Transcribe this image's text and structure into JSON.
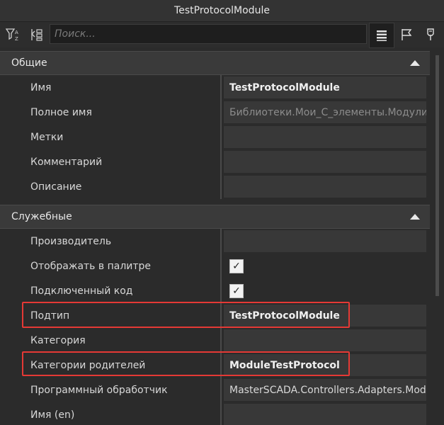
{
  "window": {
    "title": "TestProtocolModule"
  },
  "toolbar": {
    "search_placeholder": "Поиск...",
    "filter_icon": "filter-sort-icon",
    "categorize_icon": "categorize-icon",
    "list_icon": "list-icon",
    "flag_icon": "flag-icon",
    "pin_icon": "pin-icon"
  },
  "sections": [
    {
      "title": "Общие",
      "rows": [
        {
          "label": "Имя",
          "value": "TestProtocolModule"
        },
        {
          "label": "Полное имя",
          "value": "Библиотеки.Мои_С_элементы.Модули в"
        },
        {
          "label": "Метки",
          "value": ""
        },
        {
          "label": "Комментарий",
          "value": ""
        },
        {
          "label": "Описание",
          "value": ""
        }
      ]
    },
    {
      "title": "Служебные",
      "rows": [
        {
          "label": "Производитель",
          "value": ""
        },
        {
          "label": "Отображать в палитре",
          "checked": true
        },
        {
          "label": "Подключенный код",
          "checked": true
        },
        {
          "label": "Подтип",
          "value": "TestProtocolModule"
        },
        {
          "label": "Категория",
          "value": ""
        },
        {
          "label": "Категории родителей",
          "value": "ModuleTestProtocol"
        },
        {
          "label": "Программный обработчик",
          "value": "MasterSCADA.Controllers.Adapters.Modu"
        },
        {
          "label": "Имя (en)",
          "value": ""
        }
      ]
    }
  ],
  "colors": {
    "highlight": "#e53935",
    "background": "#2b2b2b",
    "section": "#3a3a3a"
  }
}
